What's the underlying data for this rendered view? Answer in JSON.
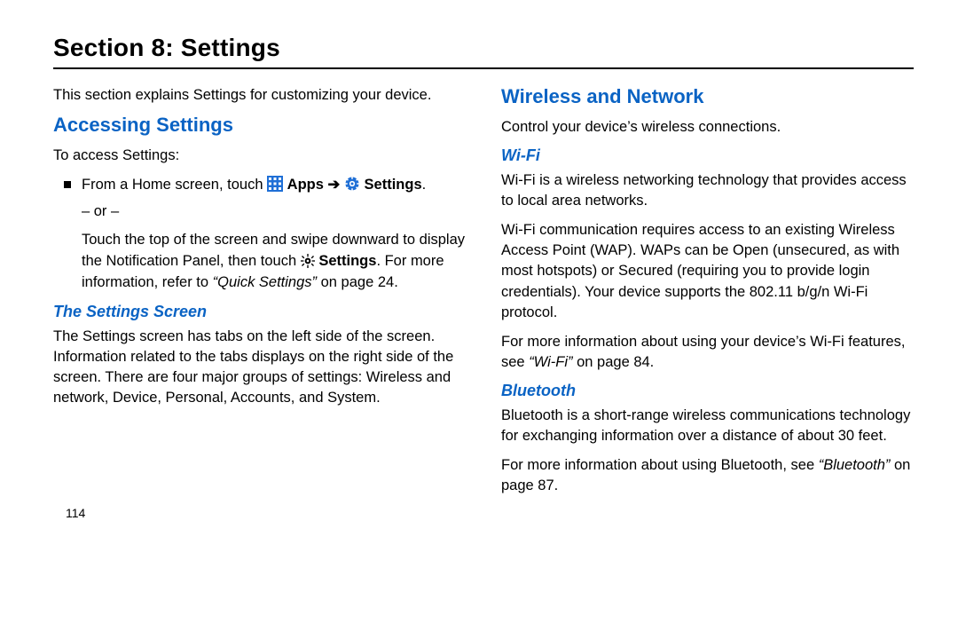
{
  "section_title": "Section 8: Settings",
  "left": {
    "intro": "This section explains Settings for customizing your device.",
    "h_access": "Accessing Settings",
    "to_access": "To access Settings:",
    "bullet_pre": "From a Home screen, touch ",
    "apps_label": "Apps",
    "arrow": " ➔ ",
    "settings_label": "Settings",
    "bullet_post": ".",
    "or_line": "– or –",
    "panel1": "Touch the top of the screen and swipe downward to display the Notification Panel, then touch ",
    "panel_settings": "Settings",
    "panel2": ". For more information, refer to ",
    "quick_settings": "“Quick Settings”",
    "panel3": " on page 24.",
    "h_settings_screen": "The Settings Screen",
    "settings_screen_body": "The Settings screen has tabs on the left side of the screen. Information related to the tabs displays on the right side of the screen. There are four major groups of settings: Wireless and network, Device, Personal, Accounts, and System."
  },
  "right": {
    "h_wireless": "Wireless and Network",
    "wireless_intro": "Control your device’s wireless connections.",
    "h_wifi": "Wi-Fi",
    "wifi_p1": "Wi-Fi is a wireless networking technology that provides access to local area networks.",
    "wifi_p2": "Wi-Fi communication requires access to an existing Wireless Access Point (WAP). WAPs can be Open (unsecured, as with most hotspots) or Secured (requiring you to provide login credentials). Your device supports the 802.11 b/g/n Wi-Fi protocol.",
    "wifi_p3a": "For more information about using your device’s Wi-Fi features, see ",
    "wifi_ref": "“Wi-Fi”",
    "wifi_p3b": " on page 84.",
    "h_bt": "Bluetooth",
    "bt_p1": "Bluetooth is a short-range wireless communications technology for exchanging information over a distance of about 30 feet.",
    "bt_p2a": "For more information about using Bluetooth, see ",
    "bt_ref": "“Bluetooth”",
    "bt_p2b": " on page 87."
  },
  "page_number": "114"
}
